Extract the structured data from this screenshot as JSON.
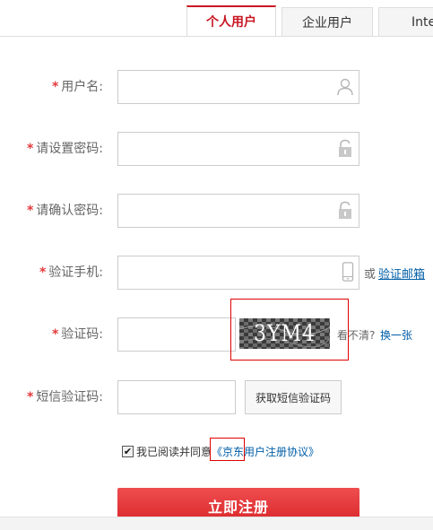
{
  "tabs": [
    {
      "label": "个人用户",
      "active": true
    },
    {
      "label": "企业用户",
      "active": false
    },
    {
      "label": "Inte",
      "active": false
    }
  ],
  "form": {
    "required_mark": "*",
    "username": {
      "label": "用户名:",
      "value": "",
      "icon": "user-icon"
    },
    "password": {
      "label": "请设置密码:",
      "value": "",
      "icon": "lock-icon"
    },
    "confirm_password": {
      "label": "请确认密码:",
      "value": "",
      "icon": "lock-icon"
    },
    "phone": {
      "label": "验证手机:",
      "value": "",
      "icon": "phone-icon",
      "or_text": "或",
      "email_link": "验证邮箱"
    },
    "captcha": {
      "label": "验证码:",
      "value": "",
      "image_text": "3YM4",
      "unclear_text": "看不清?",
      "refresh_link": "换一张"
    },
    "sms_code": {
      "label": "短信验证码:",
      "value": "",
      "button_label": "获取短信验证码"
    },
    "agreement": {
      "checked": true,
      "text": "我已阅读并同意",
      "link_prefix": "《京东",
      "link_suffix": "用户注册协议》"
    },
    "submit_label": "立即注册"
  },
  "colors": {
    "accent": "#c81623",
    "link": "#005ea7",
    "required": "#e4393c",
    "submit": "#e33a3c"
  }
}
